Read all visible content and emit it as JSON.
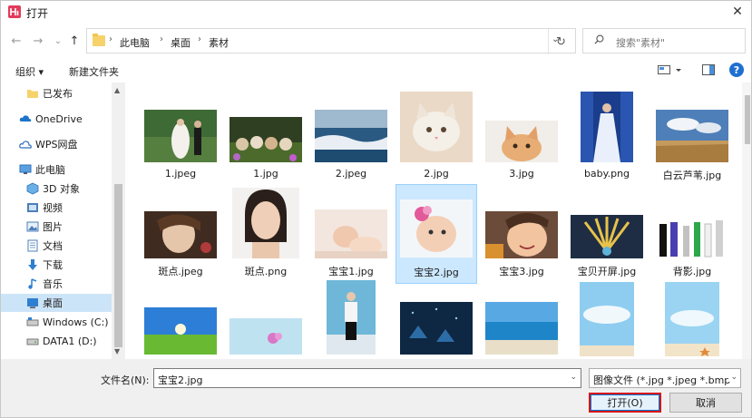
{
  "window": {
    "title": "打开",
    "close_glyph": "✕"
  },
  "nav": {
    "back_glyph": "←",
    "forward_glyph": "→",
    "recent_glyph": "⌄",
    "up_glyph": "↑",
    "breadcrumbs": [
      "此电脑",
      "桌面",
      "素材"
    ],
    "separator": "›",
    "dropdown_glyph": "⌄",
    "refresh_glyph": "↻",
    "search_placeholder": "搜索\"素材\""
  },
  "toolbar": {
    "organize": "组织 ▾",
    "new_folder": "新建文件夹",
    "help": "?"
  },
  "sidebar": {
    "items": [
      {
        "label": "已发布",
        "icon": "folder-icon"
      },
      {
        "label": "OneDrive",
        "icon": "cloud-icon"
      },
      {
        "label": "WPS网盘",
        "icon": "cloud-outline-icon"
      },
      {
        "label": "此电脑",
        "icon": "computer-icon"
      },
      {
        "label": "3D 对象",
        "icon": "cube-icon"
      },
      {
        "label": "视频",
        "icon": "video-icon"
      },
      {
        "label": "图片",
        "icon": "picture-icon"
      },
      {
        "label": "文档",
        "icon": "document-icon"
      },
      {
        "label": "下载",
        "icon": "download-icon"
      },
      {
        "label": "音乐",
        "icon": "music-icon"
      },
      {
        "label": "桌面",
        "icon": "desktop-icon"
      },
      {
        "label": "Windows (C:)",
        "icon": "drive-icon"
      },
      {
        "label": "DATA1 (D:)",
        "icon": "drive-icon"
      }
    ],
    "selected": "桌面"
  },
  "files": [
    {
      "name": "1.jpeg"
    },
    {
      "name": "1.jpg"
    },
    {
      "name": "2.jpeg"
    },
    {
      "name": "2.jpg"
    },
    {
      "name": "3.jpg"
    },
    {
      "name": "baby.png"
    },
    {
      "name": "白云芦苇.jpg"
    },
    {
      "name": "斑点.jpeg"
    },
    {
      "name": "斑点.png"
    },
    {
      "name": "宝宝1.jpg"
    },
    {
      "name": "宝宝2.jpg"
    },
    {
      "name": "宝宝3.jpg"
    },
    {
      "name": "宝贝开屏.jpg"
    },
    {
      "name": "背影.jpg"
    }
  ],
  "selected_file": "宝宝2.jpg",
  "bottom": {
    "filename_label": "文件名(N):",
    "filename_value": "宝宝2.jpg",
    "filetype_value": "图像文件 (*.jpg *.jpeg *.bmp",
    "open_button": "打开(O)",
    "cancel_button": "取消"
  },
  "colors": {
    "accent": "#0078d7",
    "selection": "#cce8ff",
    "highlight_border": "#d71414"
  }
}
